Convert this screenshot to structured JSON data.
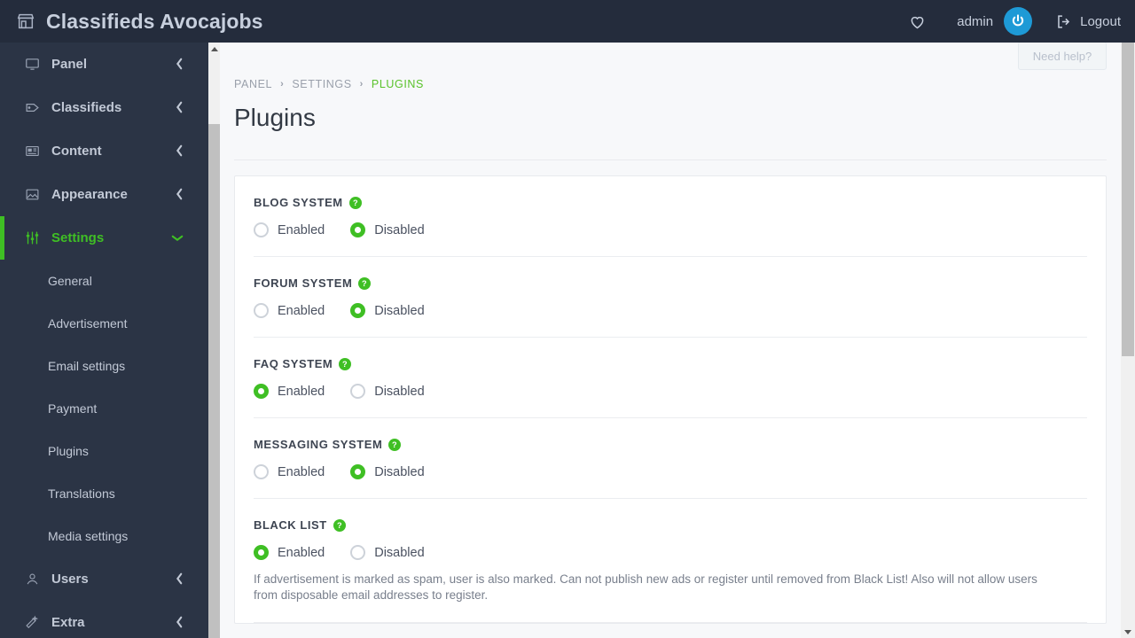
{
  "topbar": {
    "brand_icon": "store-icon",
    "brand_title": "Classifieds Avocajobs",
    "favorites_icon": "heart-icon",
    "username": "admin",
    "avatar_icon": "power-avatar-icon",
    "logout_icon": "sign-out-icon",
    "logout_label": "Logout"
  },
  "help_button": {
    "label": "Need help?"
  },
  "sidebar": {
    "items": [
      {
        "label": "Panel",
        "icon": "monitor-icon",
        "chevron": "chevron-left",
        "active": false
      },
      {
        "label": "Classifieds",
        "icon": "tag-icon",
        "chevron": "chevron-left",
        "active": false
      },
      {
        "label": "Content",
        "icon": "newspaper-icon",
        "chevron": "chevron-left",
        "active": false
      },
      {
        "label": "Appearance",
        "icon": "image-icon",
        "chevron": "chevron-left",
        "active": false
      },
      {
        "label": "Settings",
        "icon": "sliders-icon",
        "chevron": "chevron-down",
        "active": true
      }
    ],
    "sub_items": [
      {
        "label": "General"
      },
      {
        "label": "Advertisement"
      },
      {
        "label": "Email settings"
      },
      {
        "label": "Payment"
      },
      {
        "label": "Plugins"
      },
      {
        "label": "Translations"
      },
      {
        "label": "Media settings"
      }
    ],
    "items_after": [
      {
        "label": "Users",
        "icon": "user-icon",
        "chevron": "chevron-left",
        "active": false
      },
      {
        "label": "Extra",
        "icon": "magic-wand-icon",
        "chevron": "chevron-left",
        "active": false
      }
    ]
  },
  "breadcrumb": {
    "items": [
      "PANEL",
      "SETTINGS",
      "PLUGINS"
    ],
    "separator": "›"
  },
  "page": {
    "title": "Plugins"
  },
  "colors": {
    "accent_green": "#3fbf24",
    "breadcrumb_green": "#59c22a",
    "sidebar_bg": "#2b3445",
    "topbar_bg": "#242c3c",
    "avatar_blue": "#1e9ad6"
  },
  "plugins": {
    "option_enabled": "Enabled",
    "option_disabled": "Disabled",
    "help_icon": "question-circle-icon",
    "rows": [
      {
        "label": "BLOG SYSTEM",
        "selected": "Disabled",
        "description": ""
      },
      {
        "label": "FORUM SYSTEM",
        "selected": "Disabled",
        "description": ""
      },
      {
        "label": "FAQ SYSTEM",
        "selected": "Enabled",
        "description": ""
      },
      {
        "label": "MESSAGING SYSTEM",
        "selected": "Disabled",
        "description": ""
      },
      {
        "label": "BLACK LIST",
        "selected": "Enabled",
        "description": "If advertisement is marked as spam, user is also marked. Can not publish new ads or register until removed from Black List! Also will not allow users from disposable email addresses to register."
      }
    ]
  }
}
